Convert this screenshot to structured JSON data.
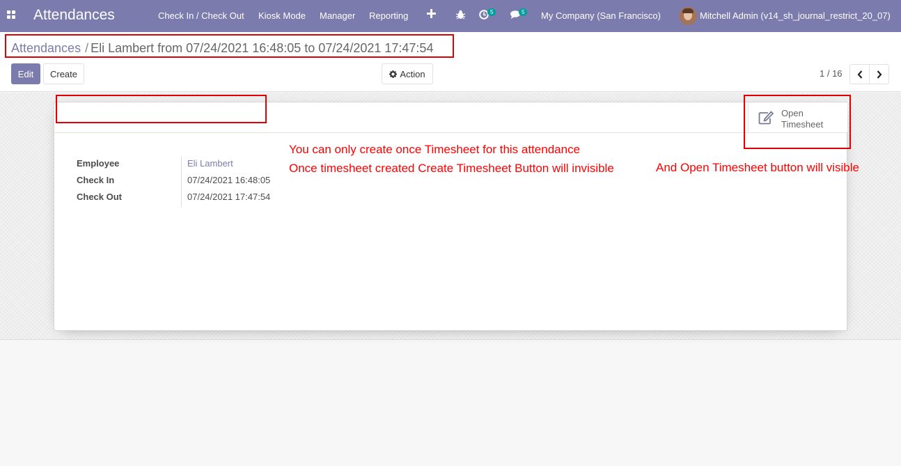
{
  "navbar": {
    "brand": "Attendances",
    "menu": [
      "Check In / Check Out",
      "Kiosk Mode",
      "Manager",
      "Reporting"
    ],
    "activity_count": "5",
    "message_count": "5",
    "company": "My Company (San Francisco)",
    "user": "Mitchell Admin (v14_sh_journal_restrict_20_07)",
    "icons": [
      "apps-icon",
      "plus-icon",
      "bug-icon",
      "clock-icon",
      "chat-icon",
      "avatar"
    ]
  },
  "breadcrumb": {
    "parent": "Attendances",
    "separator": "/",
    "current": "Eli Lambert from 07/24/2021 16:48:05 to 07/24/2021 17:47:54"
  },
  "toolbar": {
    "edit_label": "Edit",
    "create_label": "Create",
    "action_label": "Action"
  },
  "pager": {
    "value": "1 / 16"
  },
  "stat_button": {
    "line1": "Open",
    "line2": "Timesheet"
  },
  "form": {
    "employee_label": "Employee",
    "employee_value": "Eli Lambert",
    "check_in_label": "Check In",
    "check_in_value": "07/24/2021 16:48:05",
    "check_out_label": "Check Out",
    "check_out_value": "07/24/2021 17:47:54"
  },
  "annotations": {
    "note1": "You can only create once Timesheet  for this attendance",
    "note2": "Once timesheet created Create Timesheet Button will invisible",
    "note3": "And Open Timesheet button will visible",
    "color": "#ff0000"
  },
  "colors": {
    "brand": "#7c7bad",
    "badge": "#00a09d"
  }
}
